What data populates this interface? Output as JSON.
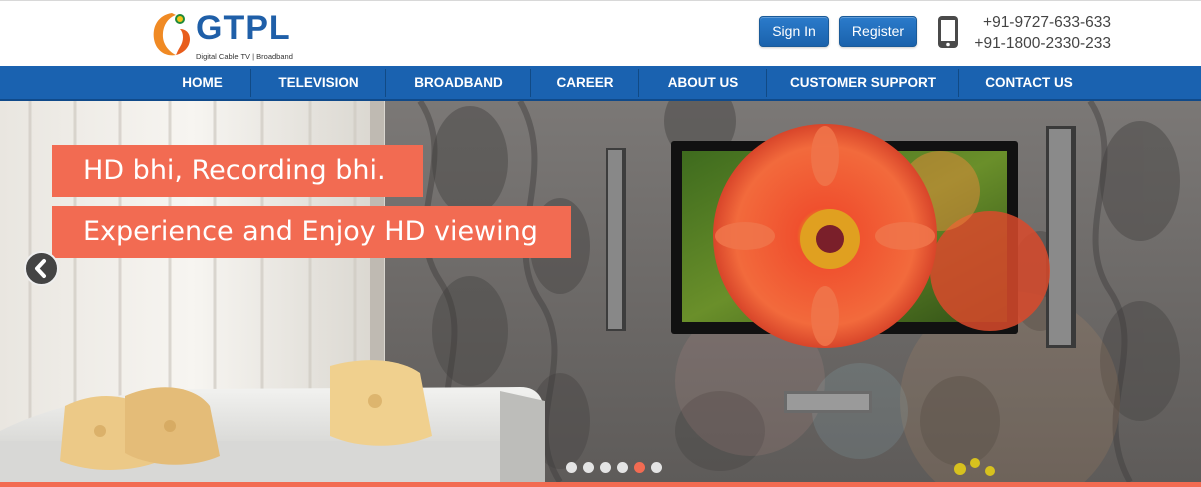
{
  "brand": {
    "name": "GTPL",
    "tagline": "Digital Cable TV | Broadband",
    "colors": {
      "primary": "#1f5fa8",
      "accent": "#f26b52",
      "logo_orange": "#f08a24"
    }
  },
  "header": {
    "signin_label": "Sign In",
    "register_label": "Register",
    "phone_icon": "mobile-phone-icon",
    "phones": [
      "+91-9727-633-633",
      "+91-1800-2330-233"
    ]
  },
  "nav": {
    "items": [
      {
        "label": "HOME"
      },
      {
        "label": "TELEVISION"
      },
      {
        "label": "BROADBAND"
      },
      {
        "label": "CAREER"
      },
      {
        "label": "ABOUT US"
      },
      {
        "label": "CUSTOMER SUPPORT"
      },
      {
        "label": "CONTACT US"
      }
    ]
  },
  "slider": {
    "caption_line1": "HD bhi, Recording bhi.",
    "caption_line2": "Experience and Enjoy HD viewing",
    "prev_icon": "chevron-left-icon",
    "slide_count": 6,
    "active_slide": 5
  }
}
